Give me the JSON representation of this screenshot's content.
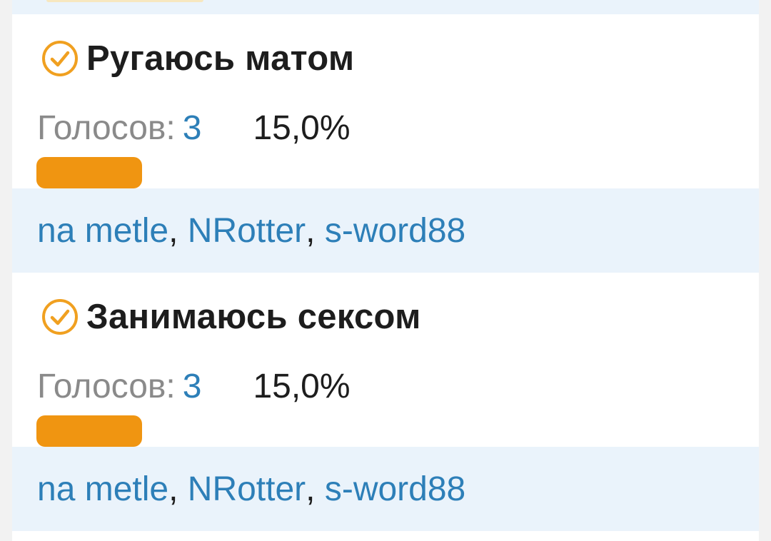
{
  "poll": {
    "options": [
      {
        "title": "Ругаюсь матом",
        "votes_label": "Голосов:",
        "votes_count": "3",
        "percent": "15,0%",
        "fraction": 0.15,
        "voters": [
          "na metle",
          "NRotter",
          "s-word88"
        ],
        "separator": ", "
      },
      {
        "title": "Занимаюсь сексом",
        "votes_label": "Голосов:",
        "votes_count": "3",
        "percent": "15,0%",
        "fraction": 0.15,
        "voters": [
          "na metle",
          "NRotter",
          "s-word88"
        ],
        "separator": ", "
      }
    ]
  },
  "colors": {
    "accent_orange": "#f09511",
    "link_blue": "#2d7fb8",
    "voters_bg": "#eaf3fb",
    "check_icon": "#f0a020"
  },
  "icons": {
    "selected": "check-circle-icon"
  }
}
